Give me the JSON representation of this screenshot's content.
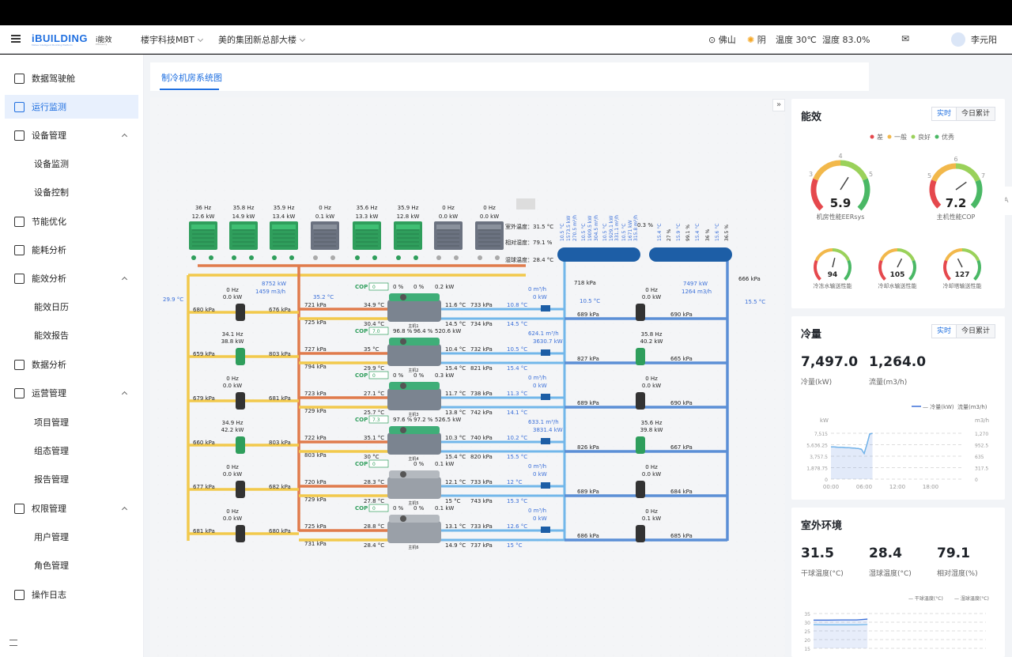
{
  "header": {
    "logo": "iBUILDING",
    "logo_sub": "Midea Intelligent Building Platform",
    "module": "i能效",
    "module_sub": "Efficiency",
    "project": "楼宇科技MBT",
    "building": "美的集团新总部大楼",
    "city": "佛山",
    "weather": "阴",
    "temp": "温度 30℃",
    "humidity": "湿度 83.0%",
    "user": "李元阳"
  },
  "sidebar": {
    "items": [
      {
        "label": "数据驾驶舱",
        "icon": "chart-pie-icon"
      },
      {
        "label": "运行监测",
        "icon": "monitor-icon"
      },
      {
        "label": "设备管理",
        "icon": "device-icon"
      },
      {
        "label": "设备监测"
      },
      {
        "label": "设备控制"
      },
      {
        "label": "节能优化",
        "icon": "leaf-icon"
      },
      {
        "label": "能耗分析",
        "icon": "bar-chart-icon"
      },
      {
        "label": "能效分析",
        "icon": "calendar-icon"
      },
      {
        "label": "能效日历"
      },
      {
        "label": "能效报告"
      },
      {
        "label": "数据分析",
        "icon": "data-icon"
      },
      {
        "label": "运营管理",
        "icon": "folder-icon"
      },
      {
        "label": "项目管理"
      },
      {
        "label": "组态管理"
      },
      {
        "label": "报告管理"
      },
      {
        "label": "权限管理",
        "icon": "user-icon"
      },
      {
        "label": "用户管理"
      },
      {
        "label": "角色管理"
      },
      {
        "label": "操作日志",
        "icon": "log-icon"
      }
    ]
  },
  "tab": "制冷机房系统图",
  "diagram": {
    "outdoor": {
      "temp": "室外温度：31.5 °C",
      "hum": "相对湿度：79.1 %",
      "wet": "湿球温度：28.4 °C"
    },
    "towers": [
      {
        "hz": "36 Hz",
        "kw": "12.6 kW",
        "on": true
      },
      {
        "hz": "35.8 Hz",
        "kw": "14.9 kW",
        "on": true
      },
      {
        "hz": "35.9 Hz",
        "kw": "13.4 kW",
        "on": true
      },
      {
        "hz": "0 Hz",
        "kw": "0.1 kW",
        "on": false
      },
      {
        "hz": "35.6 Hz",
        "kw": "13.3 kW",
        "on": true
      },
      {
        "hz": "35.9 Hz",
        "kw": "12.8 kW",
        "on": true
      },
      {
        "hz": "0 Hz",
        "kw": "0.0 kW",
        "on": false
      },
      {
        "hz": "0 Hz",
        "kw": "0.0 kW",
        "on": false
      }
    ],
    "left_temp": "29.9 °C",
    "left_power": "8752 kW",
    "left_flow": "1459 m3/h",
    "left_supply_temp": "35.2 °C",
    "right_power": "7497 kW",
    "right_flow": "1264 m3/h",
    "right_temp": "15.5 °C",
    "right_kpa": "666 kPa",
    "mid_kpa": "718 kPa",
    "mid_temp": "10.5 °C",
    "valve_pct": "0.3 %",
    "header_vals": [
      "10.5 °C",
      "1573.5 kW",
      "270.5 m³/h",
      "10.5 °C",
      "1909.5 kW",
      "304.5 m³/h",
      "10.5 °C",
      "1929.1 kW",
      "331.1 m³/h",
      "10.5 °C",
      "1671 kW",
      "315.8 m³/h"
    ],
    "right_header_vals": [
      "15.4 °C",
      "27 %",
      "15.9 °C",
      "99.1 %",
      "15.4 °C",
      "36 %",
      "15.6 °C",
      "36.5 %"
    ],
    "rows": [
      {
        "cw_hz": "0 Hz",
        "cw_kw": "0.0 kW",
        "cw_on": false,
        "cw_in": "680 kPa",
        "cw_out": "676 kPa",
        "cond_in_kpa": "721 kPa",
        "cond_out_kpa": "725 kPa",
        "cond_in_t": "34.9 °C",
        "cond_out_t": "30.4 °C",
        "cop": "0",
        "load": "0 %",
        "amp": "0 %",
        "kw": "0.2 kW",
        "ch_on": true,
        "name": "主机1",
        "evap_out_t": "11.6 °C",
        "evap_out_kpa": "733 kPa",
        "evap_in_t": "14.5 °C",
        "evap_in_kpa": "734 kPa",
        "flow": "0 m³/h",
        "cap": "0 kW",
        "chw_t": "10.8 °C",
        "chw_in_t": "14.5 °C",
        "chp_in": "689 kPa",
        "chp_hz": "0 Hz",
        "chp_kw": "0.0 kW",
        "chp_on": false,
        "chp_out": "690 kPa"
      },
      {
        "cw_hz": "34.1 Hz",
        "cw_kw": "38.8 kW",
        "cw_on": true,
        "cw_in": "659 kPa",
        "cw_out": "803 kPa",
        "cond_in_kpa": "727 kPa",
        "cond_out_kpa": "794 kPa",
        "cond_in_t": "35 °C",
        "cond_out_t": "29.9 °C",
        "cop": "7.0",
        "load": "96.8 %",
        "amp": "96.4 %",
        "kw": "520.6 kW",
        "ch_on": true,
        "name": "主机2",
        "evap_out_t": "10.4 °C",
        "evap_out_kpa": "732 kPa",
        "evap_in_t": "15.4 °C",
        "evap_in_kpa": "821 kPa",
        "flow": "624.1 m³/h",
        "cap": "3630.7 kW",
        "chw_t": "10.5 °C",
        "chw_in_t": "15.4 °C",
        "chp_in": "827 kPa",
        "chp_hz": "35.8 Hz",
        "chp_kw": "40.2 kW",
        "chp_on": true,
        "chp_out": "665 kPa"
      },
      {
        "cw_hz": "0 Hz",
        "cw_kw": "0.0 kW",
        "cw_on": false,
        "cw_in": "679 kPa",
        "cw_out": "681 kPa",
        "cond_in_kpa": "723 kPa",
        "cond_out_kpa": "729 kPa",
        "cond_in_t": "27.1 °C",
        "cond_out_t": "25.7 °C",
        "cop": "0",
        "load": "0 %",
        "amp": "0 %",
        "kw": "0.3 kW",
        "ch_on": true,
        "name": "主机3",
        "evap_out_t": "11.7 °C",
        "evap_out_kpa": "738 kPa",
        "evap_in_t": "13.8 °C",
        "evap_in_kpa": "742 kPa",
        "flow": "0 m³/h",
        "cap": "0 kW",
        "chw_t": "11.3 °C",
        "chw_in_t": "14.1 °C",
        "chp_in": "689 kPa",
        "chp_hz": "0 Hz",
        "chp_kw": "0.0 kW",
        "chp_on": false,
        "chp_out": "690 kPa"
      },
      {
        "cw_hz": "34.9 Hz",
        "cw_kw": "42.2 kW",
        "cw_on": true,
        "cw_in": "660 kPa",
        "cw_out": "803 kPa",
        "cond_in_kpa": "722 kPa",
        "cond_out_kpa": "803 kPa",
        "cond_in_t": "35.1 °C",
        "cond_out_t": "30 °C",
        "cop": "7.3",
        "load": "97.6 %",
        "amp": "97.2 %",
        "kw": "526.5 kW",
        "ch_on": true,
        "name": "主机4",
        "evap_out_t": "10.3 °C",
        "evap_out_kpa": "740 kPa",
        "evap_in_t": "15.4 °C",
        "evap_in_kpa": "820 kPa",
        "flow": "633.1 m³/h",
        "cap": "3831.4 kW",
        "chw_t": "10.2 °C",
        "chw_in_t": "15.5 °C",
        "chp_in": "826 kPa",
        "chp_hz": "35.6 Hz",
        "chp_kw": "39.8 kW",
        "chp_on": true,
        "chp_out": "667 kPa"
      },
      {
        "cw_hz": "0 Hz",
        "cw_kw": "0.0 kW",
        "cw_on": false,
        "cw_in": "677 kPa",
        "cw_out": "682 kPa",
        "cond_in_kpa": "720 kPa",
        "cond_out_kpa": "729 kPa",
        "cond_in_t": "28.3 °C",
        "cond_out_t": "27.8 °C",
        "cop": "0",
        "load": "",
        "amp": "0 %",
        "kw": "0.1 kW",
        "ch_on": false,
        "name": "主机5",
        "evap_out_t": "12.1 °C",
        "evap_out_kpa": "733 kPa",
        "evap_in_t": "15 °C",
        "evap_in_kpa": "743 kPa",
        "flow": "0 m³/h",
        "cap": "0 kW",
        "chw_t": "12 °C",
        "chw_in_t": "15.3 °C",
        "chp_in": "689 kPa",
        "chp_hz": "0 Hz",
        "chp_kw": "0.0 kW",
        "chp_on": false,
        "chp_out": "684 kPa"
      },
      {
        "cw_hz": "0 Hz",
        "cw_kw": "0.0 kW",
        "cw_on": false,
        "cw_in": "681 kPa",
        "cw_out": "680 kPa",
        "cond_in_kpa": "725 kPa",
        "cond_out_kpa": "731 kPa",
        "cond_in_t": "28.8 °C",
        "cond_out_t": "28.4 °C",
        "cop": "0",
        "load": "0 %",
        "amp": "0 %",
        "kw": "0.1 kW",
        "ch_on": false,
        "name": "主机6",
        "evap_out_t": "13.1 °C",
        "evap_out_kpa": "733 kPa",
        "evap_in_t": "14.9 °C",
        "evap_in_kpa": "737 kPa",
        "flow": "0 m³/h",
        "cap": "0 kW",
        "chw_t": "12.6 °C",
        "chw_in_t": "15 °C",
        "chp_in": "686 kPa",
        "chp_hz": "0 Hz",
        "chp_kw": "0.1 kW",
        "chp_on": false,
        "chp_out": "685 kPa"
      }
    ]
  },
  "efficiency": {
    "title": "能效",
    "toggle": [
      "实时",
      "今日累计"
    ],
    "legend": [
      {
        "label": "差",
        "color": "#e5484d"
      },
      {
        "label": "一般",
        "color": "#f2b84b"
      },
      {
        "label": "良好",
        "color": "#9ad15a"
      },
      {
        "label": "优秀",
        "color": "#4ab865"
      }
    ],
    "gauges": [
      {
        "value": "5.9",
        "label": "机房性能EERsys",
        "ticks": [
          "3",
          "4",
          "5"
        ],
        "fraction": 0.62
      },
      {
        "value": "7.2",
        "label": "主机性能COP",
        "ticks": [
          "5",
          "6",
          "7"
        ],
        "fraction": 0.7
      },
      {
        "value": "94",
        "label": "冷冻水输送性能",
        "fraction": 0.55
      },
      {
        "value": "105",
        "label": "冷却水输送性能",
        "fraction": 0.6
      },
      {
        "value": "127",
        "label": "冷却塔输送性能",
        "fraction": 0.4
      }
    ]
  },
  "cooling": {
    "title": "冷量",
    "toggle": [
      "实时",
      "今日累计"
    ],
    "capacity": "7,497.0",
    "capacity_label": "冷量(kW)",
    "flow": "1,264.0",
    "flow_label": "流量(m3/h)",
    "legend": [
      "冷量(kW)",
      "流量(m3/h)"
    ],
    "y_left_unit": "kW",
    "y_right_unit": "m3/h",
    "y_left": [
      "7,515",
      "5,636.25",
      "3,757.5",
      "1,878.75",
      "0"
    ],
    "y_right": [
      "1,270",
      "952.5",
      "635",
      "317.5",
      "0"
    ],
    "x": [
      "00:00",
      "06:00",
      "12:00",
      "18:00"
    ],
    "chart_data": {
      "type": "line",
      "series": [
        {
          "name": "冷量(kW)",
          "x": [
            0,
            1,
            2,
            3,
            4,
            5,
            5.5,
            6,
            6.5,
            7,
            7.5
          ],
          "values": [
            5300,
            5250,
            5200,
            5150,
            5100,
            5000,
            4900,
            4200,
            5700,
            7400,
            7500
          ]
        },
        {
          "name": "流量(m3/h)",
          "x": [
            0,
            1,
            2,
            3,
            4,
            5,
            5.5,
            6,
            6.5,
            7,
            7.5
          ],
          "values": [
            895,
            885,
            880,
            870,
            860,
            845,
            830,
            710,
            960,
            1250,
            1264
          ]
        }
      ],
      "xlim": [
        0,
        24
      ],
      "ylim": [
        0,
        7515
      ]
    }
  },
  "outdoor_env": {
    "title": "室外环境",
    "dry": "31.5",
    "dry_label": "干球温度(°C)",
    "wet": "28.4",
    "wet_label": "湿球温度(°C)",
    "hum": "79.1",
    "hum_label": "相对湿度(%)",
    "legend": [
      "干球温度(°C)",
      "湿球温度(°C)"
    ],
    "y": [
      "35",
      "30",
      "25",
      "20",
      "15"
    ],
    "chart_data": {
      "type": "line",
      "series": [
        {
          "name": "干球温度(°C)",
          "x": [
            0,
            2,
            4,
            6,
            7.5
          ],
          "values": [
            31.2,
            31.2,
            31.3,
            31.3,
            31.8
          ]
        },
        {
          "name": "湿球温度(°C)",
          "x": [
            0,
            2,
            4,
            6,
            7.5
          ],
          "values": [
            28.6,
            28.5,
            28.5,
            28.5,
            28.7
          ]
        }
      ],
      "ylim": [
        15,
        35
      ]
    }
  }
}
